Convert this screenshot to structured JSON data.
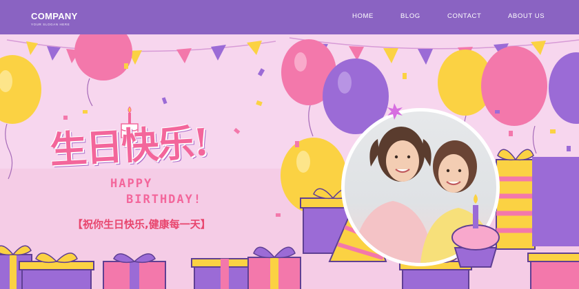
{
  "navbar": {
    "brand": "COMPANY",
    "slogan": "YOUR SLOGAN HERE",
    "links": [
      {
        "label": "HOME"
      },
      {
        "label": "BLOG"
      },
      {
        "label": "CONTACT"
      },
      {
        "label": "ABOUT US"
      }
    ]
  },
  "banner": {
    "title_cn": "生日快乐!",
    "subtitle_line1": "HAPPY",
    "subtitle_line2": "BIRTHDAY!",
    "greeting": "【祝你生日快乐,健康每一天】"
  },
  "colors": {
    "nav_bg": "#8a63c2",
    "banner_bg": "#f7d6ee",
    "pink": "#f3669b",
    "purple": "#9b6bd6",
    "yellow": "#fbd243"
  },
  "icons": [
    "balloon-icon",
    "bunting-flag-icon",
    "gift-box-icon",
    "party-hat-icon",
    "cupcake-icon",
    "birthday-cake-icon"
  ]
}
